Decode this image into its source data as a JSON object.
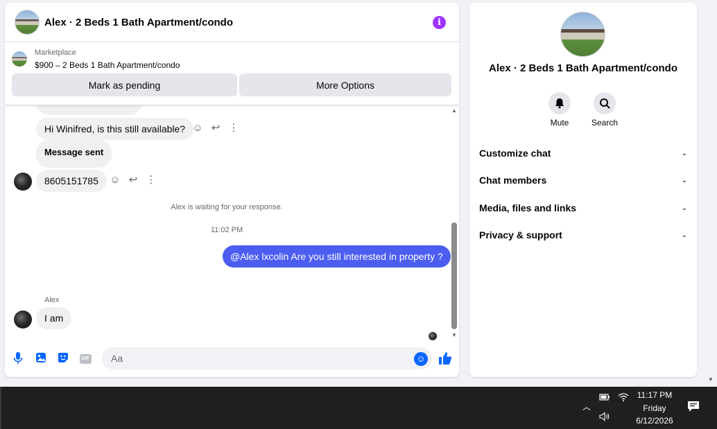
{
  "header": {
    "title": "Alex · 2 Beds 1 Bath Apartment/condo",
    "info_icon": "i"
  },
  "listing": {
    "source": "Marketplace",
    "price_title": "$900 – 2 Beds 1 Bath Apartment/condo",
    "pending_label": "Mark as pending",
    "more_label": "More Options"
  },
  "messages": {
    "m1": "Hi Winifred, is this still available?",
    "m2": "Message sent",
    "m3": "8605151785",
    "system_note": "Alex is waiting for your response.",
    "timestamp": "11:02 PM",
    "m4": "@Alex lxcolin Are you still interested in property ?",
    "sender": "Alex",
    "m5": "I am"
  },
  "composer": {
    "placeholder": "Aa",
    "gif_label": "GIF"
  },
  "info_panel": {
    "title": "Alex · 2 Beds 1 Bath Apartment/condo",
    "mute_label": "Mute",
    "search_label": "Search",
    "sections": [
      "Customize chat",
      "Chat members",
      "Media, files and links",
      "Privacy & support"
    ]
  },
  "taskbar": {
    "time": "11:17 PM",
    "day": "Friday",
    "date": "6/12/2026"
  },
  "colors": {
    "accent": "#0866ff",
    "own_bubble": "#4c5ef0",
    "info_badge": "#a033ff"
  }
}
